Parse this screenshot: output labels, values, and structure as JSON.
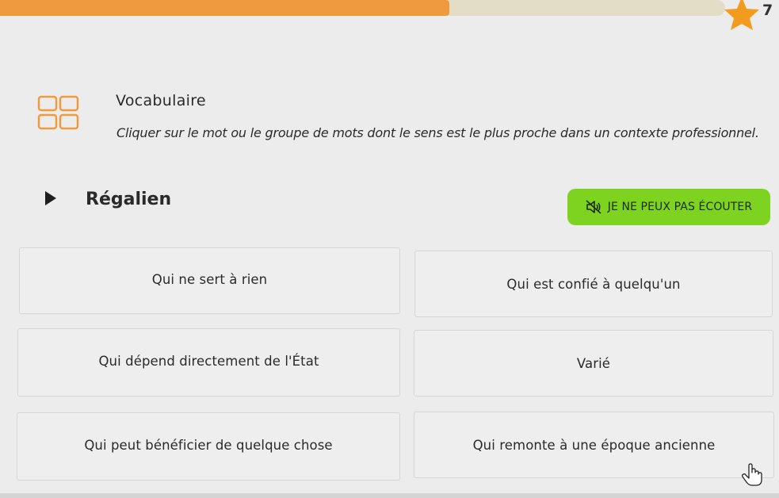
{
  "progress": {
    "value": 0.62,
    "fill_color": "#ef9a3f",
    "track_color": "#e3dcc6"
  },
  "score": {
    "value": "7",
    "icon": "star-icon",
    "icon_color": "#f29b1f"
  },
  "exercise": {
    "icon": "grid-icon",
    "title": "Vocabulaire",
    "instruction": "Cliquer sur le mot ou le groupe de mots dont le sens est le plus proche dans un contexte professionnel."
  },
  "word": {
    "play_icon": "play-icon",
    "text": "Régalien"
  },
  "cant_listen": {
    "icon": "mute-icon",
    "label": "JE NE PEUX PAS ÉCOUTER",
    "color": "#7ed321"
  },
  "options": [
    {
      "label": "Qui ne sert à rien"
    },
    {
      "label": "Qui est confié à quelqu'un"
    },
    {
      "label": "Qui dépend directement de l'État"
    },
    {
      "label": "Varié"
    },
    {
      "label": "Qui peut bénéficier de quelque chose"
    },
    {
      "label": "Qui remonte à une époque ancienne"
    }
  ],
  "cursor": {
    "icon": "hand-cursor-icon"
  }
}
